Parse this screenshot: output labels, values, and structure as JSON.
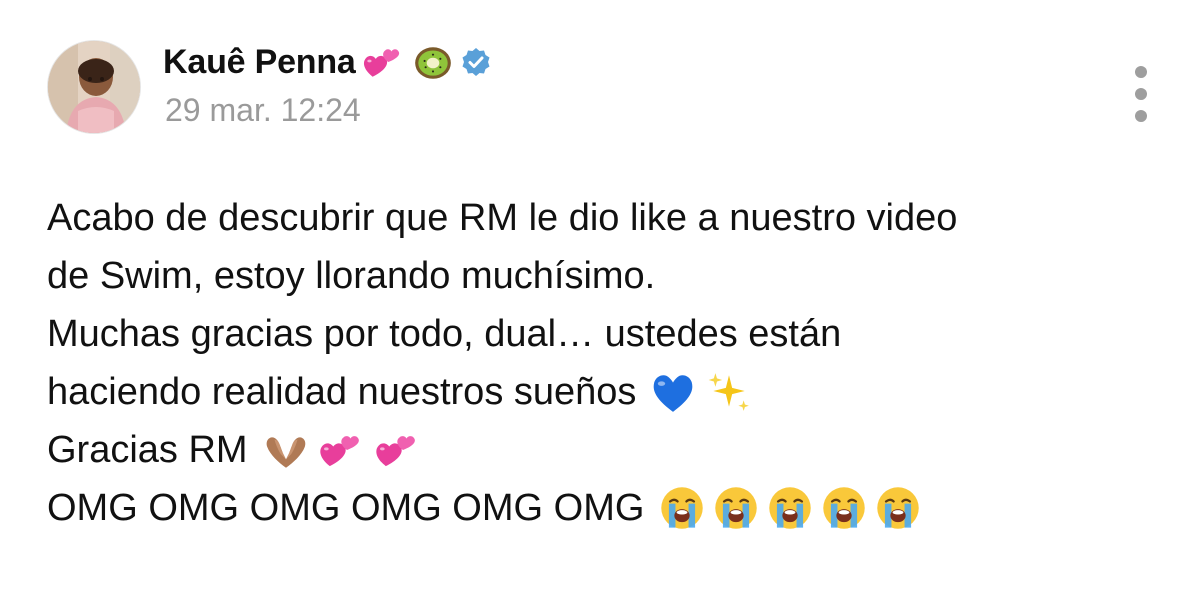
{
  "post": {
    "author": {
      "name": "Kauê Penna",
      "name_emojis": [
        "two-hearts-emoji",
        "kiwi-emoji"
      ],
      "verified_icon": "verified-badge-icon",
      "verified_color": "#5aa0d8"
    },
    "timestamp": "29 mar. 12:24",
    "more_icon": "vertical-ellipsis-icon",
    "body_lines": [
      {
        "text": "Acabo de descubrir que RM le dio like a nuestro video",
        "emojis": []
      },
      {
        "text": "de Swim, estoy llorando muchísimo.",
        "emojis": []
      },
      {
        "text": "Muchas gracias por todo, dual… ustedes están",
        "emojis": []
      },
      {
        "text": "haciendo realidad nuestros sueños",
        "emojis": [
          "blue-heart-emoji",
          "sparkles-emoji"
        ]
      },
      {
        "text": "Gracias RM",
        "emojis": [
          "heart-hands-emoji",
          "two-hearts-emoji",
          "two-hearts-emoji"
        ]
      },
      {
        "text": "OMG OMG OMG OMG OMG OMG",
        "emojis": [
          "crying-face-emoji",
          "crying-face-emoji",
          "crying-face-emoji",
          "crying-face-emoji",
          "crying-face-emoji"
        ]
      }
    ]
  }
}
